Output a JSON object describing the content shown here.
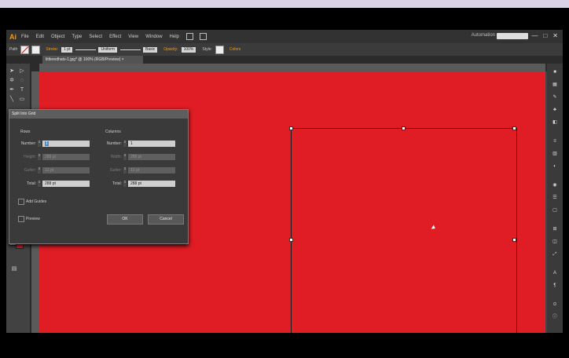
{
  "app": {
    "logo": "Ai",
    "menu": [
      "File",
      "Edit",
      "Object",
      "Type",
      "Select",
      "Effect",
      "View",
      "Window",
      "Help"
    ],
    "workspace": "Automation",
    "window_buttons": [
      "—",
      "□",
      "✕"
    ]
  },
  "control_bar": {
    "path_label": "Path",
    "stroke_label": "Stroke:",
    "stroke_value": "1 pt",
    "uniform_label": "Uniform",
    "basic_label": "Basic",
    "opacity_label": "Opacity:",
    "opacity_value": "100%",
    "style_label": "Style:",
    "colors_label": "Colors",
    "accent": "#ff9a00"
  },
  "document_tab": {
    "title": "littleredhats-1.jpg* @ 100% (RGB/Preview)",
    "close": "×"
  },
  "dialog": {
    "title": "Split Into Grid",
    "rows": {
      "header": "Rows",
      "number_label": "Number:",
      "number_value": "1",
      "height_label": "Height:",
      "height_value": "288 pt",
      "gutter_label": "Gutter:",
      "gutter_value": "12 pt",
      "total_label": "Total:",
      "total_value": "288 pt"
    },
    "columns": {
      "header": "Columns",
      "number_label": "Number:",
      "number_value": "1",
      "width_label": "Width:",
      "width_value": "288 pt",
      "gutter_label": "Gutter:",
      "gutter_value": "12 pt",
      "total_label": "Total:",
      "total_value": "288 pt"
    },
    "add_guides_label": "Add Guides",
    "preview_label": "Preview",
    "ok_label": "OK",
    "cancel_label": "Cancel"
  },
  "canvas": {
    "background_color": "#e01c24",
    "selection_color": "#1b1b1b"
  },
  "icons": [
    "selection-arrow-icon",
    "direct-selection-icon",
    "pen-icon",
    "type-icon",
    "line-icon",
    "rectangle-icon",
    "brush-icon",
    "rotate-icon",
    "hand-icon",
    "zoom-icon",
    "fill-swatch-icon",
    "stroke-swatch-icon",
    "screen-mode-icon"
  ]
}
